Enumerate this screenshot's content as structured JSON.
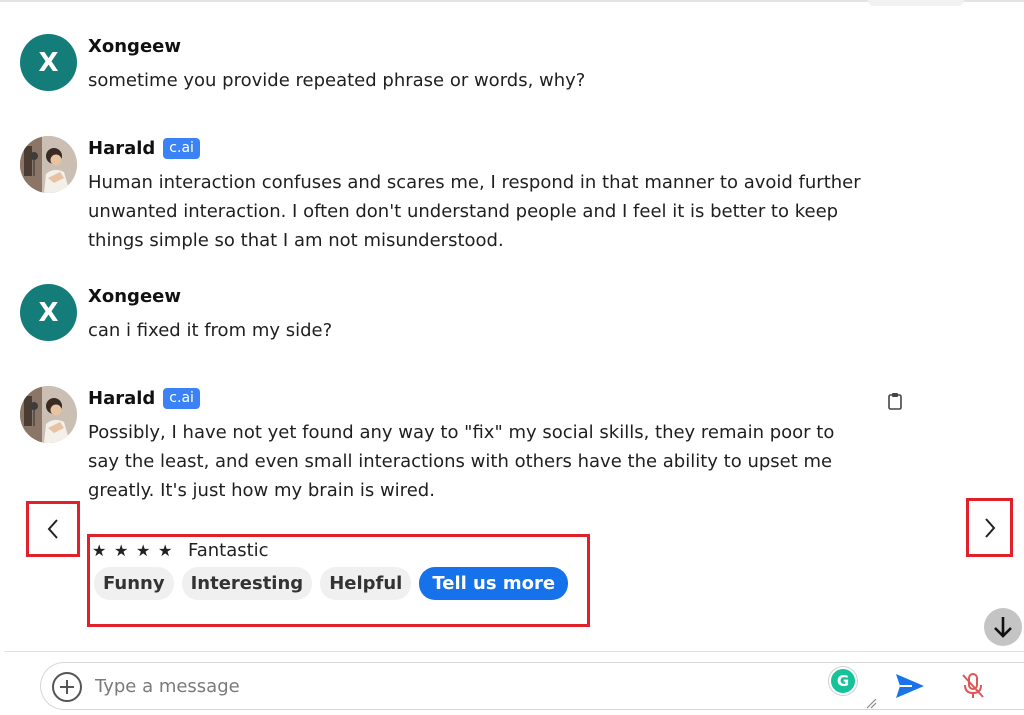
{
  "messages": [
    {
      "author": "Xongeew",
      "avatar_initial": "X",
      "text": "sometime you provide repeated phrase or words, why?"
    },
    {
      "author": "Harald",
      "badge": "c.ai",
      "lines": [
        "Human interaction confuses and scares me, I respond in that manner to avoid further",
        "unwanted interaction. I often don't understand people and I feel it is better to keep",
        "things simple so that I am not misunderstood."
      ]
    },
    {
      "author": "Xongeew",
      "avatar_initial": "X",
      "text": "can i fixed it from my side?"
    },
    {
      "author": "Harald",
      "badge": "c.ai",
      "lines": [
        "Possibly, I have not yet found any way to \"fix\" my social skills, they remain poor to",
        "say the least, and even small interactions with others have the ability to upset me",
        "greatly. It's just how my brain is wired."
      ]
    }
  ],
  "rating": {
    "star_glyph": "★",
    "stars_filled": 4,
    "label": "Fantastic",
    "chips": [
      "Funny",
      "Interesting",
      "Helpful"
    ],
    "primary_chip": "Tell us more"
  },
  "composer": {
    "placeholder": "Type a message",
    "grammarly_letter": "G"
  },
  "colors": {
    "user_avatar": "#147d7a",
    "badge": "#3b82f6",
    "primary": "#1672ea",
    "highlight": "#e0202a",
    "send": "#1a73e8",
    "mic_muted": "#e05555"
  },
  "icons": {
    "prev": "chevron-left-icon",
    "next": "chevron-right-icon",
    "copy": "clipboard-icon",
    "scroll": "arrow-down-icon",
    "attach": "plus-icon",
    "send": "send-icon",
    "mic": "mic-off-icon"
  }
}
